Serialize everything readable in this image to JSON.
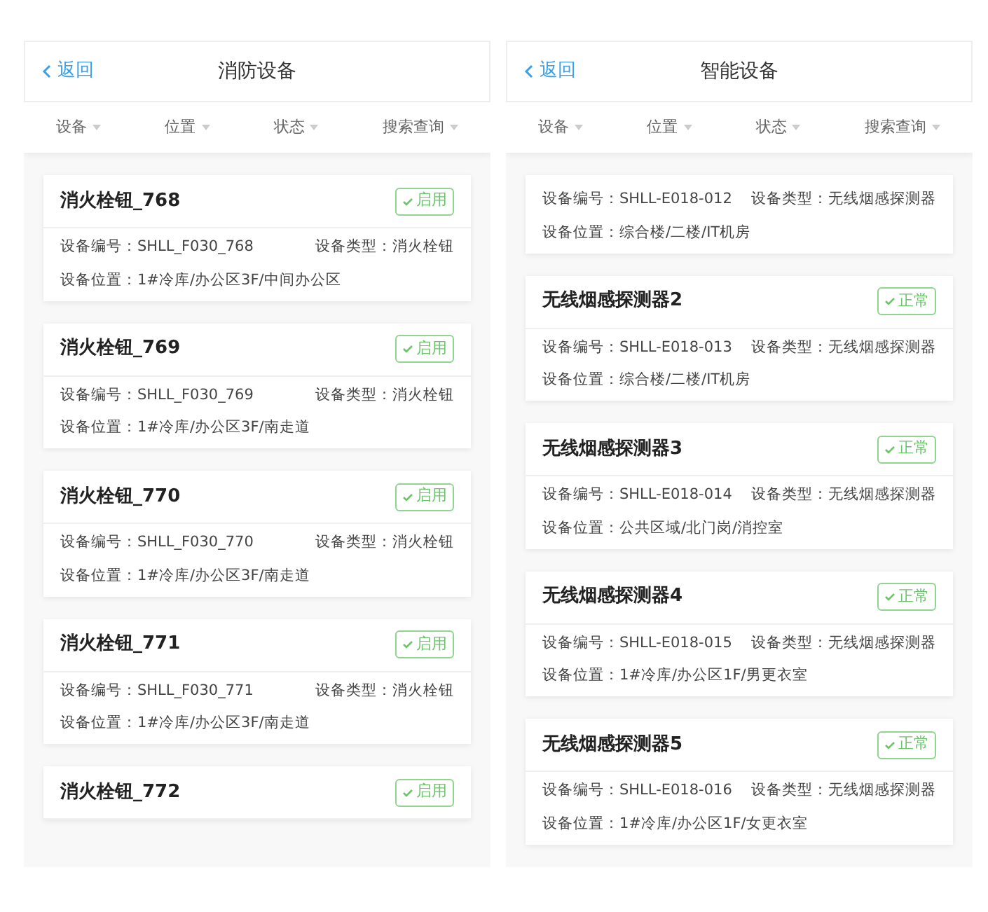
{
  "panels": [
    {
      "back": "返回",
      "title": "消防设备",
      "filters": [
        "设备",
        "位置",
        "状态",
        "搜索查询"
      ],
      "cards": [
        {
          "title": "消火栓钮_768",
          "status": "启用",
          "number": "设备编号：SHLL_F030_768",
          "type": "设备类型：消火栓钮",
          "location": "设备位置：1#冷库/办公区3F/中间办公区"
        },
        {
          "title": "消火栓钮_769",
          "status": "启用",
          "number": "设备编号：SHLL_F030_769",
          "type": "设备类型：消火栓钮",
          "location": "设备位置：1#冷库/办公区3F/南走道"
        },
        {
          "title": "消火栓钮_770",
          "status": "启用",
          "number": "设备编号：SHLL_F030_770",
          "type": "设备类型：消火栓钮",
          "location": "设备位置：1#冷库/办公区3F/南走道"
        },
        {
          "title": "消火栓钮_771",
          "status": "启用",
          "number": "设备编号：SHLL_F030_771",
          "type": "设备类型：消火栓钮",
          "location": "设备位置：1#冷库/办公区3F/南走道"
        },
        {
          "title": "消火栓钮_772",
          "status": "启用"
        }
      ]
    },
    {
      "back": "返回",
      "title": "智能设备",
      "filters": [
        "设备",
        "位置",
        "状态",
        "搜索查询"
      ],
      "cards": [
        {
          "number": "设备编号：SHLL-E018-012",
          "type": "设备类型：无线烟感探测器",
          "location": "设备位置：综合楼/二楼/IT机房"
        },
        {
          "title": "无线烟感探测器2",
          "status": "正常",
          "number": "设备编号：SHLL-E018-013",
          "type": "设备类型：无线烟感探测器",
          "location": "设备位置：综合楼/二楼/IT机房"
        },
        {
          "title": "无线烟感探测器3",
          "status": "正常",
          "number": "设备编号：SHLL-E018-014",
          "type": "设备类型：无线烟感探测器",
          "location": "设备位置：公共区域/北门岗/消控室"
        },
        {
          "title": "无线烟感探测器4",
          "status": "正常",
          "number": "设备编号：SHLL-E018-015",
          "type": "设备类型：无线烟感探测器",
          "location": "设备位置：1#冷库/办公区1F/男更衣室"
        },
        {
          "title": "无线烟感探测器5",
          "status": "正常",
          "number": "设备编号：SHLL-E018-016",
          "type": "设备类型：无线烟感探测器",
          "location": "设备位置：1#冷库/办公区1F/女更衣室"
        }
      ]
    }
  ]
}
